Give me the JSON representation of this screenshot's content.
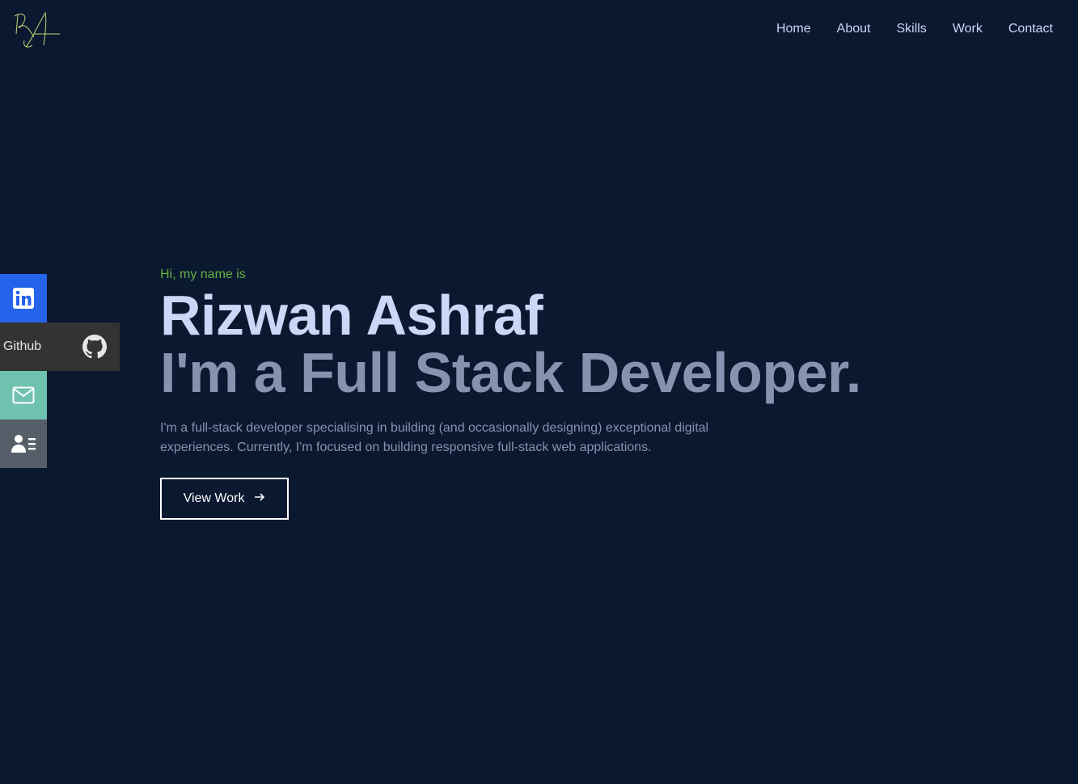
{
  "header": {
    "logo_icon": "signature-logo",
    "nav": [
      {
        "label": "Home"
      },
      {
        "label": "About"
      },
      {
        "label": "Skills"
      },
      {
        "label": "Work"
      },
      {
        "label": "Contact"
      }
    ]
  },
  "social": {
    "linkedin": {
      "icon": "linkedin-icon"
    },
    "github": {
      "label": "Github",
      "icon": "github-icon"
    },
    "email": {
      "icon": "mail-icon"
    },
    "resume": {
      "icon": "resume-icon"
    }
  },
  "hero": {
    "intro": "Hi, my name is",
    "name": "Rizwan Ashraf",
    "tagline": "I'm a Full Stack Developer.",
    "description": "I'm a full-stack developer specialising in building (and occasionally designing) exceptional digital experiences. Currently, I'm focused on building responsive full-stack web applications.",
    "cta_label": "View Work",
    "cta_icon": "arrow-right-icon"
  },
  "colors": {
    "background": "#0a192f",
    "accent": "#64b043",
    "heading": "#ccd6f6",
    "subheading": "#8892b0",
    "linkedin": "#2563eb",
    "github": "#333333",
    "email": "#6fc2b0",
    "resume": "#565f69"
  }
}
